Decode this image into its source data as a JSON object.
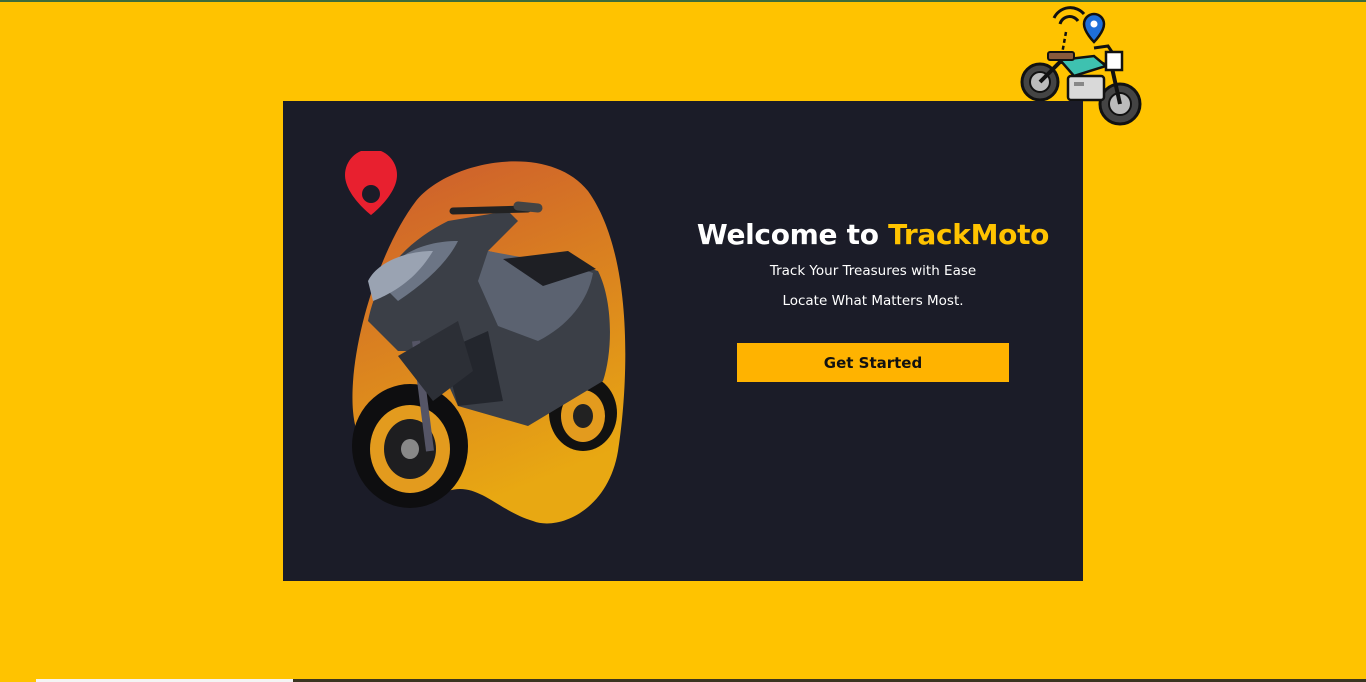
{
  "hero": {
    "headline_prefix": "Welcome to ",
    "brand_name": "TrackMoto",
    "tagline_1": "Track Your Treasures with Ease",
    "tagline_2": "Locate What Matters Most.",
    "cta_label": "Get Started"
  },
  "colors": {
    "background": "#FFC300",
    "card": "#1b1c28",
    "brand_accent": "#FFC300",
    "button": "#FFB300",
    "pin": "#e8202f"
  },
  "icons": {
    "corner": "motorcycle-tracking-icon",
    "hero_pin": "location-pin-icon",
    "hero_vehicle": "scooter-illustration"
  }
}
